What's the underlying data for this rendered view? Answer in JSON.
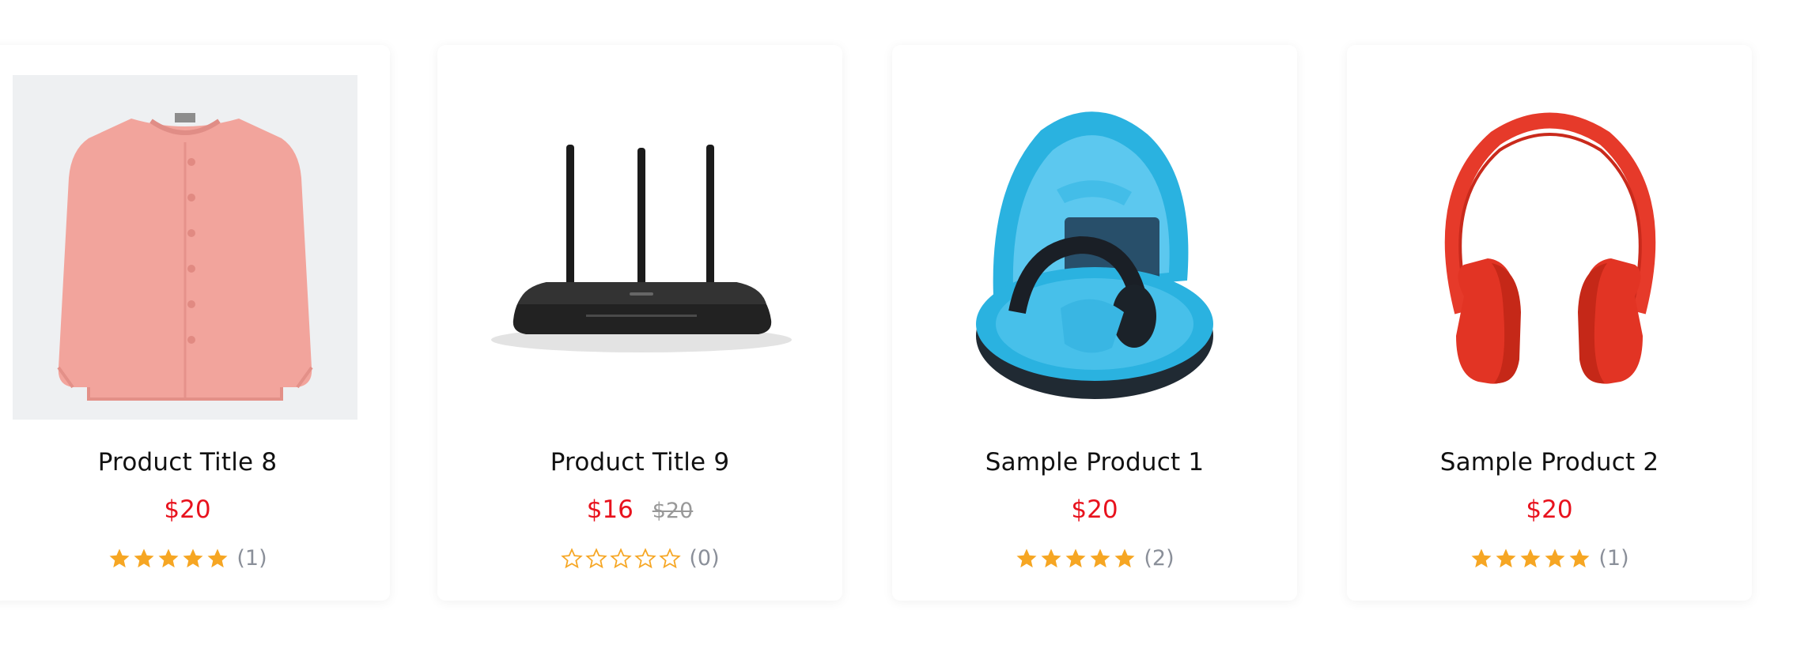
{
  "products": [
    {
      "title": "Product Title 8",
      "price": "$20",
      "old_price": "",
      "stars": 5,
      "count": "(1)",
      "image": "pink-cardigan-image"
    },
    {
      "title": "Product Title 9",
      "price": "$16",
      "old_price": "$20",
      "stars": 0,
      "count": "(0)",
      "image": "router-image"
    },
    {
      "title": "Sample Product 1",
      "price": "$20",
      "old_price": "",
      "stars": 5,
      "count": "(2)",
      "image": "headphone-case-image"
    },
    {
      "title": "Sample Product 2",
      "price": "$20",
      "old_price": "",
      "stars": 5,
      "count": "(1)",
      "image": "red-headphones-image"
    }
  ],
  "colors": {
    "price": "#e8121d",
    "star": "#f6a623",
    "muted": "#999999"
  }
}
